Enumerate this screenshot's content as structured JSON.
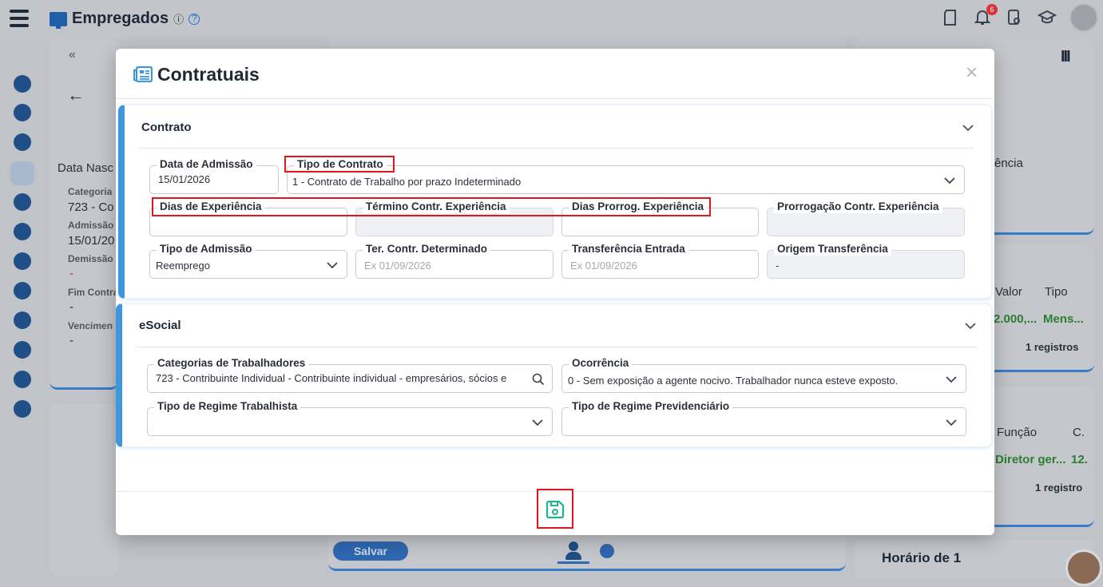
{
  "app": {
    "title": "Empregados",
    "info_glyph": "ⓘ",
    "help_glyph": "?",
    "notification_count": "6",
    "save_label": "Salvar"
  },
  "background": {
    "left_label_data_nasc": "Data Nasc",
    "left_category_label": "Categoria",
    "left_category_value": "723 - Co",
    "left_admissao_label": "Admissão",
    "left_admissao_value": "15/01/20",
    "left_demissao_label": "Demissão",
    "left_demissao_value": "-",
    "left_fim_contrato_label": "Fim Contra",
    "left_fim_contrato_value": "-",
    "left_vencimento_label": "Vencimen",
    "left_vencimento_value": "-",
    "right_ciencia": "ência",
    "right_valor_header": "Valor",
    "right_tipo_header": "Tipo",
    "right_valor_value": "2.000,...",
    "right_tipo_value": "Mens...",
    "right_registros_1": "1 registros",
    "right_funcao_header": "Função",
    "right_c_header": "C.",
    "right_funcao_value": "Diretor ger...",
    "right_c_value": "12.",
    "right_registros_2": "1 registro",
    "right_horario_title": "Horário de 1"
  },
  "modal": {
    "title": "Contratuais",
    "close_glyph": "×",
    "sections": {
      "contrato": {
        "title": "Contrato",
        "fields": {
          "data_admissao": {
            "label": "Data de Admissão",
            "value": "15/01/2026"
          },
          "tipo_contrato": {
            "label": "Tipo de Contrato",
            "value": "1 - Contrato de Trabalho por prazo Indeterminado"
          },
          "dias_experiencia": {
            "label": "Dias de Experiência",
            "value": ""
          },
          "termino_experiencia": {
            "label": "Término Contr. Experiência",
            "value": ""
          },
          "dias_prorrog": {
            "label": "Dias Prorrog. Experiência",
            "value": ""
          },
          "prorrogacao": {
            "label": "Prorrogação Contr. Experiência",
            "value": ""
          },
          "tipo_admissao": {
            "label": "Tipo de Admissão",
            "value": "Reemprego"
          },
          "ter_contr_determinado": {
            "label": "Ter. Contr. Determinado",
            "placeholder": "Ex 01/09/2026"
          },
          "transferencia_entrada": {
            "label": "Transferência Entrada",
            "placeholder": "Ex 01/09/2026"
          },
          "origem_transferencia": {
            "label": "Origem Transferência",
            "value": "-"
          }
        }
      },
      "esocial": {
        "title": "eSocial",
        "fields": {
          "categorias": {
            "label": "Categorias de Trabalhadores",
            "value": "723 - Contribuinte Individual - Contribuinte individual - empresários, sócios e"
          },
          "ocorrencia": {
            "label": "Ocorrência",
            "value": "0 - Sem exposição a agente nocivo. Trabalhador nunca esteve exposto."
          },
          "regime_trabalhista": {
            "label": "Tipo de Regime Trabalhista",
            "value": ""
          },
          "regime_previdenciario": {
            "label": "Tipo de Regime Previdenciário",
            "value": ""
          }
        }
      }
    }
  },
  "colors": {
    "accent_blue": "#3d97dd",
    "highlight_red": "#e3141b",
    "save_icon_teal": "#1cb58f"
  }
}
